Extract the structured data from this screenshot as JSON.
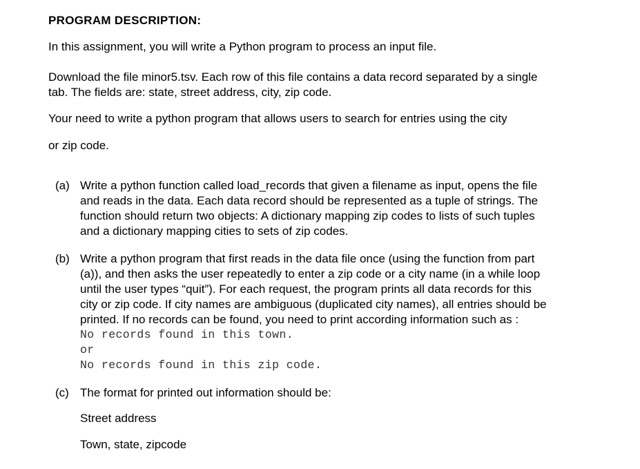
{
  "heading": "PROGRAM DESCRIPTION:",
  "intro": "In this assignment, you will write a Python program to process an input file.",
  "download": [
    "Download the file minor5.tsv. Each row of this file contains a data record separated by a single",
    "tab. The fields are: state, street address, city, zip code."
  ],
  "need": [
    "Your need to write a python program that allows users to search for entries using the city",
    "or zip code."
  ],
  "items": [
    {
      "label": "(a)",
      "lines": [
        "Write a python function called load_records that given a filename as input, opens the file",
        "and reads in the data. Each data record should be represented as a tuple of strings. The",
        "function should return two objects: A dictionary mapping zip codes to lists of such tuples",
        "and a dictionary mapping cities to sets of zip codes."
      ]
    },
    {
      "label": "(b)",
      "lines": [
        "Write a python program that first reads in the data file once (using the function from part",
        "(a)), and then asks the user repeatedly to enter a zip code or a city name (in a while loop",
        "until the user types “quit”). For each request, the program prints all data records for this",
        "city or zip code. If city names are ambiguous (duplicated city names), all entries should be",
        "printed. If no records can be found, you need to print according information such as :"
      ],
      "code": [
        "No records found in this town.",
        "or",
        "No records found in this zip code."
      ]
    },
    {
      "label": "(c)",
      "lines": [
        "The format for printed out information should be:"
      ],
      "extra": [
        "Street address",
        "Town, state, zipcode"
      ]
    }
  ]
}
